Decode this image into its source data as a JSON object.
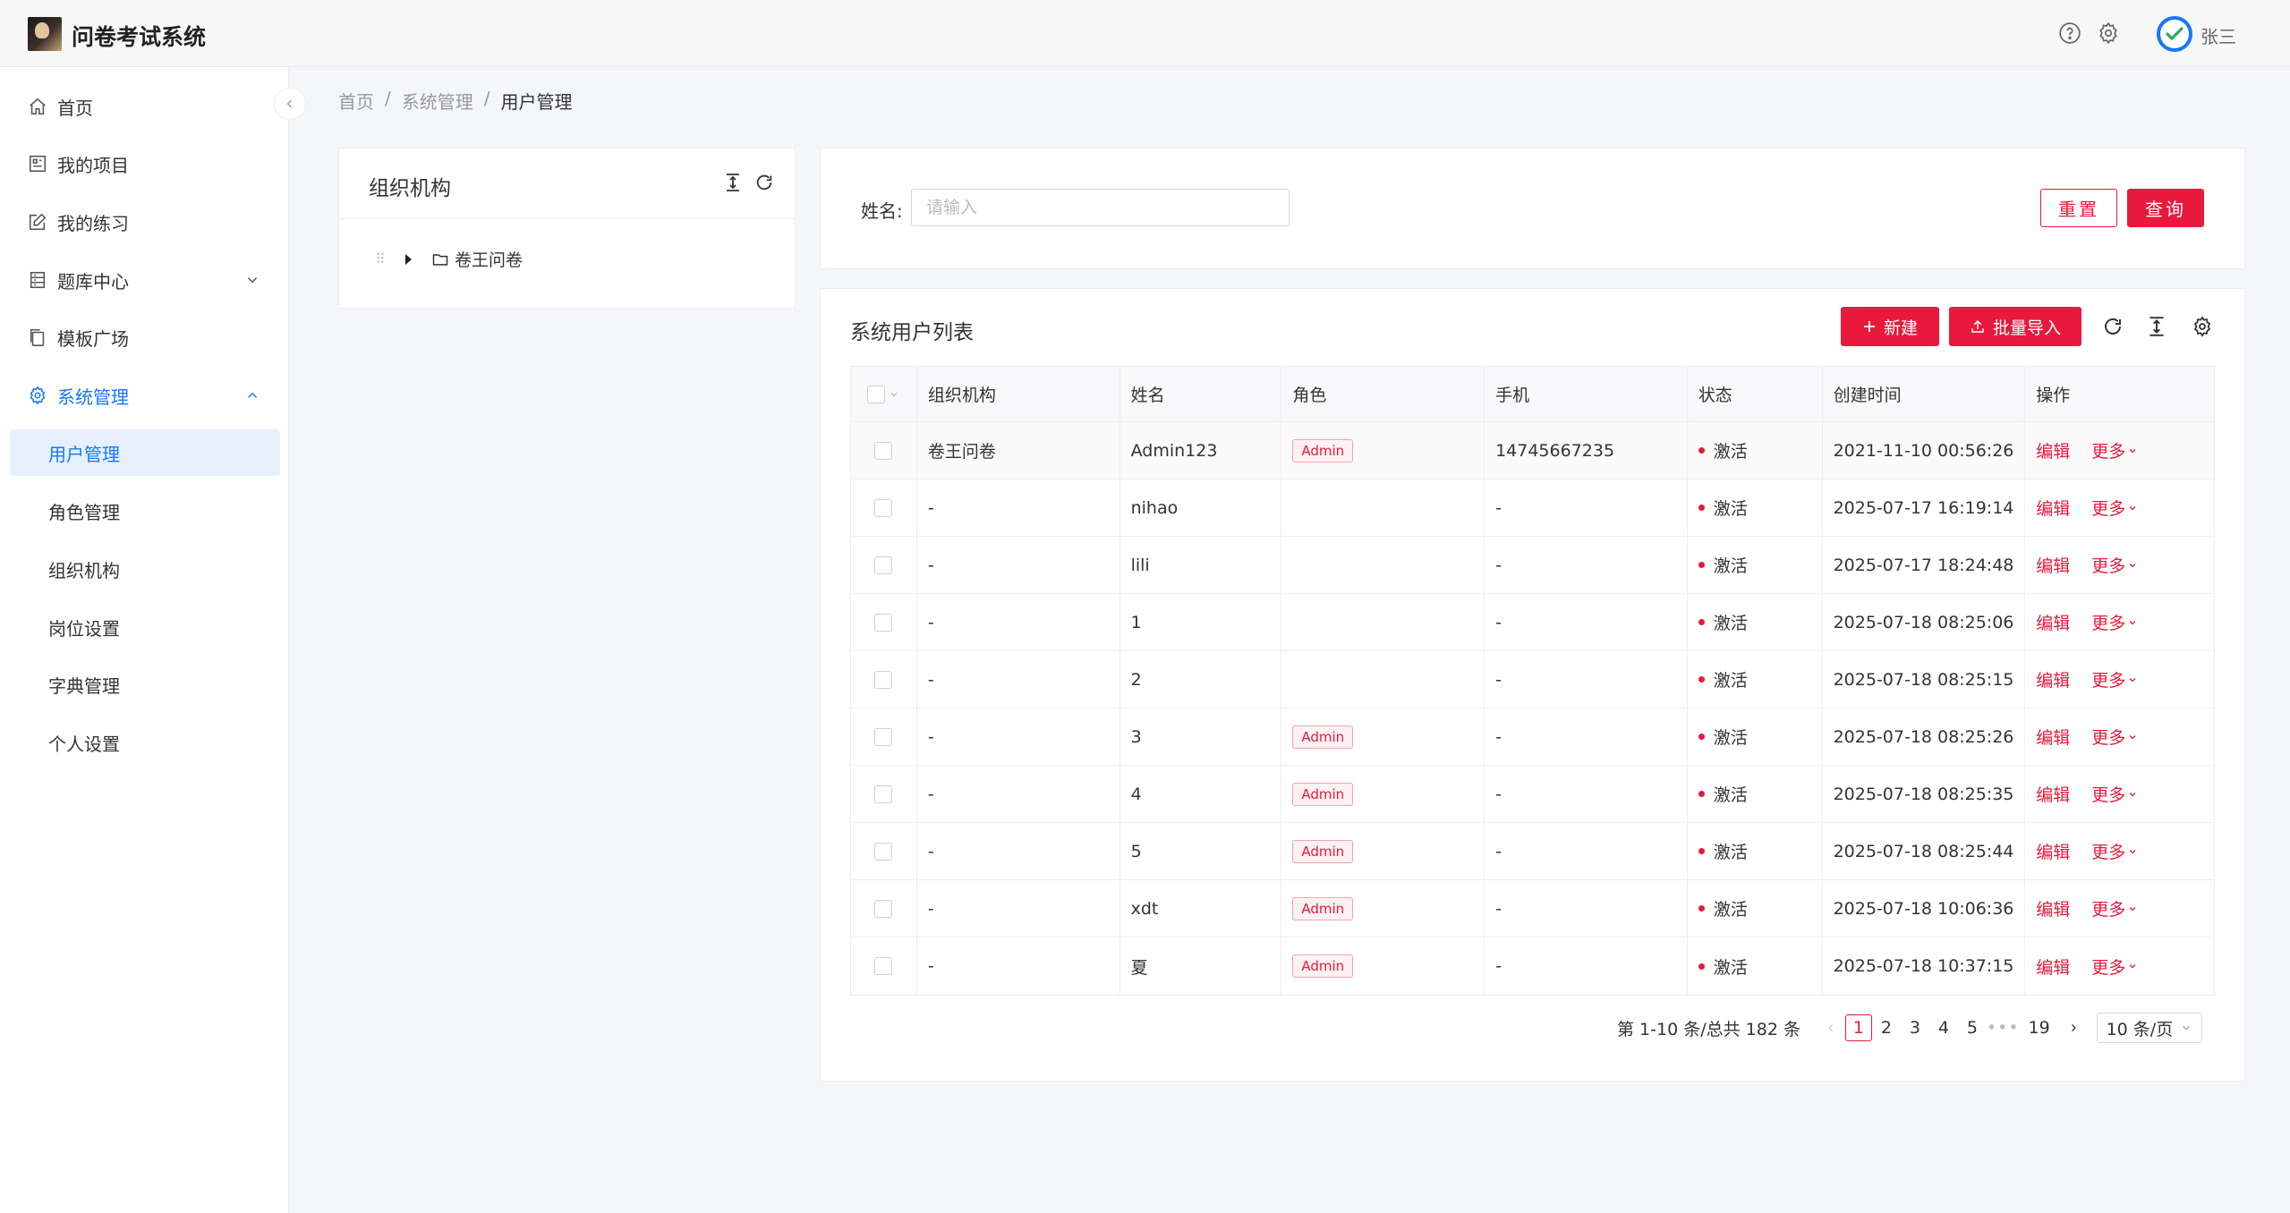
{
  "app": {
    "title": "问卷考试系统",
    "username": "张三"
  },
  "sidebar": {
    "items": [
      {
        "label": "首页"
      },
      {
        "label": "我的项目"
      },
      {
        "label": "我的练习"
      },
      {
        "label": "题库中心"
      },
      {
        "label": "模板广场"
      },
      {
        "label": "系统管理"
      }
    ],
    "submenu": [
      {
        "label": "用户管理"
      },
      {
        "label": "角色管理"
      },
      {
        "label": "组织机构"
      },
      {
        "label": "岗位设置"
      },
      {
        "label": "字典管理"
      },
      {
        "label": "个人设置"
      }
    ]
  },
  "breadcrumb": {
    "home": "首页",
    "sep": "/",
    "section": "系统管理",
    "current": "用户管理"
  },
  "org": {
    "title": "组织机构",
    "node": "卷王问卷"
  },
  "search": {
    "label": "姓名:",
    "placeholder": "请输入",
    "reset": "重置",
    "query": "查询"
  },
  "list": {
    "title": "系统用户列表",
    "new_label": "新建",
    "import_label": "批量导入",
    "columns": [
      "组织机构",
      "姓名",
      "角色",
      "手机",
      "状态",
      "创建时间",
      "操作"
    ],
    "edit_label": "编辑",
    "more_label": "更多",
    "rows": [
      {
        "org": "卷王问卷",
        "name": "Admin123",
        "role": "Admin",
        "phone": "14745667235",
        "status": "激活",
        "created": "2021-11-10 00:56:26"
      },
      {
        "org": "-",
        "name": "nihao",
        "role": "",
        "phone": "-",
        "status": "激活",
        "created": "2025-07-17 16:19:14"
      },
      {
        "org": "-",
        "name": "lili",
        "role": "",
        "phone": "-",
        "status": "激活",
        "created": "2025-07-17 18:24:48"
      },
      {
        "org": "-",
        "name": "1",
        "role": "",
        "phone": "-",
        "status": "激活",
        "created": "2025-07-18 08:25:06"
      },
      {
        "org": "-",
        "name": "2",
        "role": "",
        "phone": "-",
        "status": "激活",
        "created": "2025-07-18 08:25:15"
      },
      {
        "org": "-",
        "name": "3",
        "role": "Admin",
        "phone": "-",
        "status": "激活",
        "created": "2025-07-18 08:25:26"
      },
      {
        "org": "-",
        "name": "4",
        "role": "Admin",
        "phone": "-",
        "status": "激活",
        "created": "2025-07-18 08:25:35"
      },
      {
        "org": "-",
        "name": "5",
        "role": "Admin",
        "phone": "-",
        "status": "激活",
        "created": "2025-07-18 08:25:44"
      },
      {
        "org": "-",
        "name": "xdt",
        "role": "Admin",
        "phone": "-",
        "status": "激活",
        "created": "2025-07-18 10:06:36"
      },
      {
        "org": "-",
        "name": "夏",
        "role": "Admin",
        "phone": "-",
        "status": "激活",
        "created": "2025-07-18 10:37:15"
      }
    ]
  },
  "pagination": {
    "summary": "第 1-10 条/总共 182 条",
    "pages": [
      "1",
      "2",
      "3",
      "4",
      "5"
    ],
    "ellipsis": "•••",
    "last": "19",
    "page_size": "10 条/页"
  },
  "colors": {
    "accent": "#e8193c",
    "primary": "#1677ff"
  },
  "icons": {
    "help": "question-circle-icon",
    "settings": "gear-icon",
    "avatar": "check-avatar-icon"
  }
}
